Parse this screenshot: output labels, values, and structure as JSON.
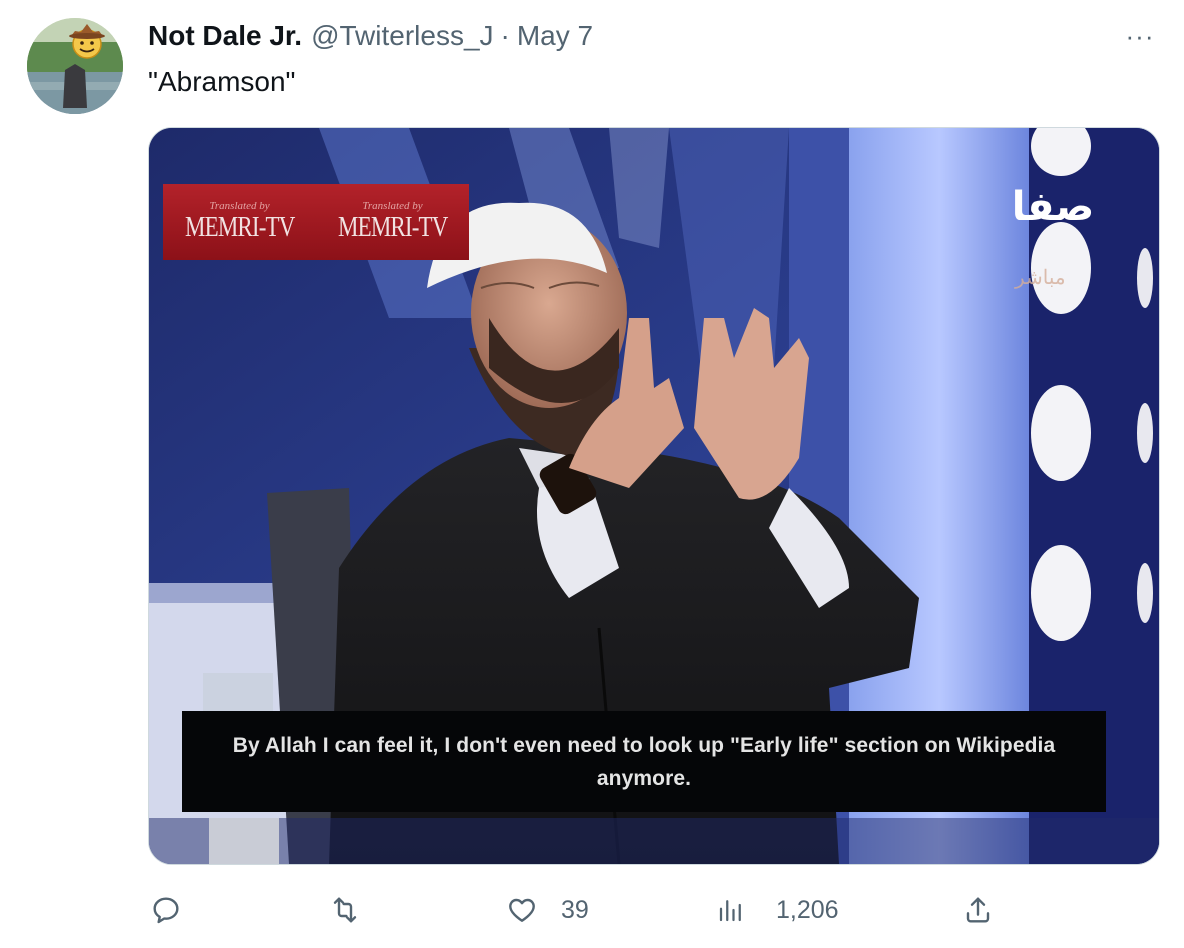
{
  "tweet": {
    "display_name": "Not Dale Jr.",
    "handle": "@Twiterless_J",
    "separator": "·",
    "date": "May 7",
    "text": "\"Abramson\"",
    "more_label": "···",
    "avatar_icon": "emoji-cowboy-avatar"
  },
  "media": {
    "watermark_left_small": "Translated by",
    "watermark_left": "MEMRI-TV",
    "watermark_right_small": "Translated by",
    "watermark_right": "MEMRI-TV",
    "channel_logo": "صفا",
    "channel_sub": "مباشر",
    "caption": "By Allah I can feel it, I don't even need to look up \"Early life\" section on Wikipedia anymore."
  },
  "actions": {
    "reply": {
      "icon": "reply-icon",
      "count": ""
    },
    "retweet": {
      "icon": "retweet-icon",
      "count": ""
    },
    "like": {
      "icon": "heart-icon",
      "count": "39"
    },
    "views": {
      "icon": "analytics-icon",
      "count": "1,206"
    },
    "share": {
      "icon": "share-icon",
      "count": ""
    }
  },
  "colors": {
    "text_primary": "#0f1419",
    "text_secondary": "#536471",
    "border": "#cfd9de"
  }
}
